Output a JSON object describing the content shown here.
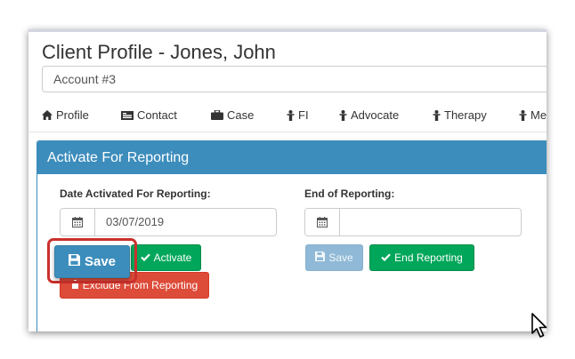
{
  "header": {
    "title": "Client Profile - Jones, John",
    "account_value": "Account #3"
  },
  "tabs": [
    {
      "label": "Profile",
      "icon": "home-icon"
    },
    {
      "label": "Contact",
      "icon": "contact-card-icon"
    },
    {
      "label": "Case",
      "icon": "briefcase-icon"
    },
    {
      "label": "FI",
      "icon": "person-icon"
    },
    {
      "label": "Advocate",
      "icon": "person-icon"
    },
    {
      "label": "Therapy",
      "icon": "person-icon"
    },
    {
      "label": "Me",
      "icon": "person-icon"
    }
  ],
  "panel": {
    "title": "Activate For Reporting",
    "date_activated_label": "Date Activated For Reporting:",
    "date_activated_value": "03/07/2019",
    "end_label": "End of Reporting:",
    "end_value": "",
    "activate_label": "Activate",
    "exclude_label": "Exclude From Reporting",
    "end_save_label": "Save",
    "end_reporting_label": "End Reporting"
  },
  "focused_button": {
    "label": "Save"
  },
  "colors": {
    "primary": "#3c8dbc",
    "success": "#00a65a",
    "danger": "#dd4b39",
    "highlight": "#c9302c"
  }
}
